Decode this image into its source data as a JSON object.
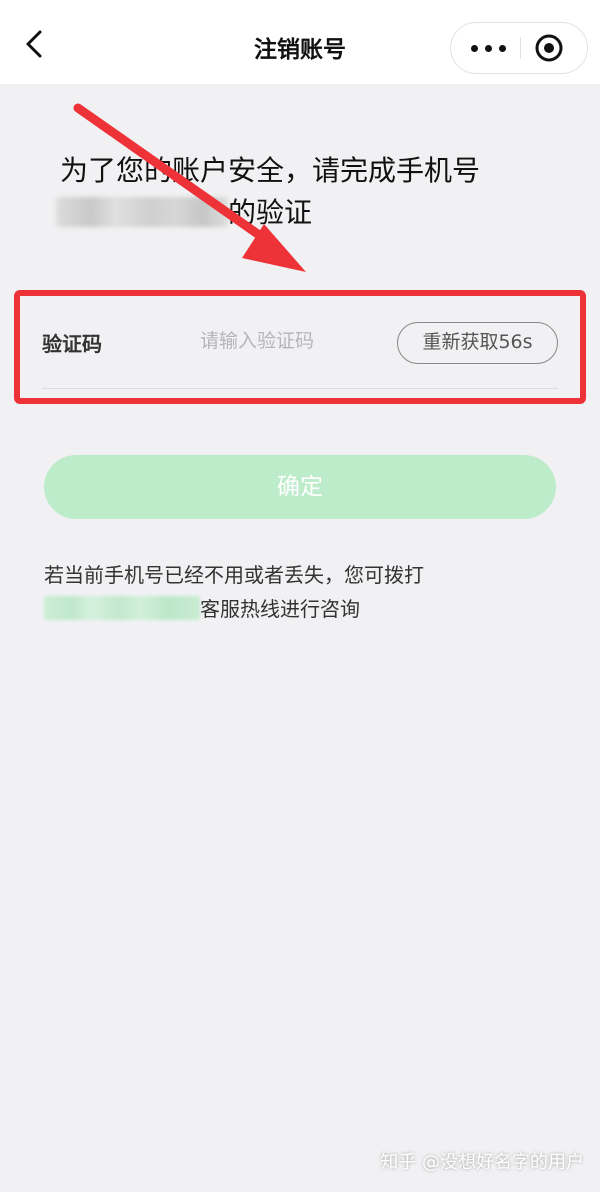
{
  "nav": {
    "title": "注销账号",
    "back_icon": "chevron-left-icon",
    "more_icon": "more-dots-icon",
    "close_icon": "target-close-icon"
  },
  "heading": {
    "line1": "为了您的账户安全，请完成手机号",
    "suffix": "的验证"
  },
  "form": {
    "code_label": "验证码",
    "code_placeholder": "请输入验证码",
    "code_value": "",
    "resend_label": "重新获取56s"
  },
  "confirm_label": "确定",
  "help": {
    "line1": "若当前手机号已经不用或者丢失，您可拨打",
    "line2_suffix": "客服热线进行咨询"
  },
  "watermark": "知乎 @没想好名字的用户",
  "colors": {
    "accent_disabled": "#bdeccb",
    "annotation_red": "#ee3338",
    "page_bg": "#f1f1f3"
  }
}
